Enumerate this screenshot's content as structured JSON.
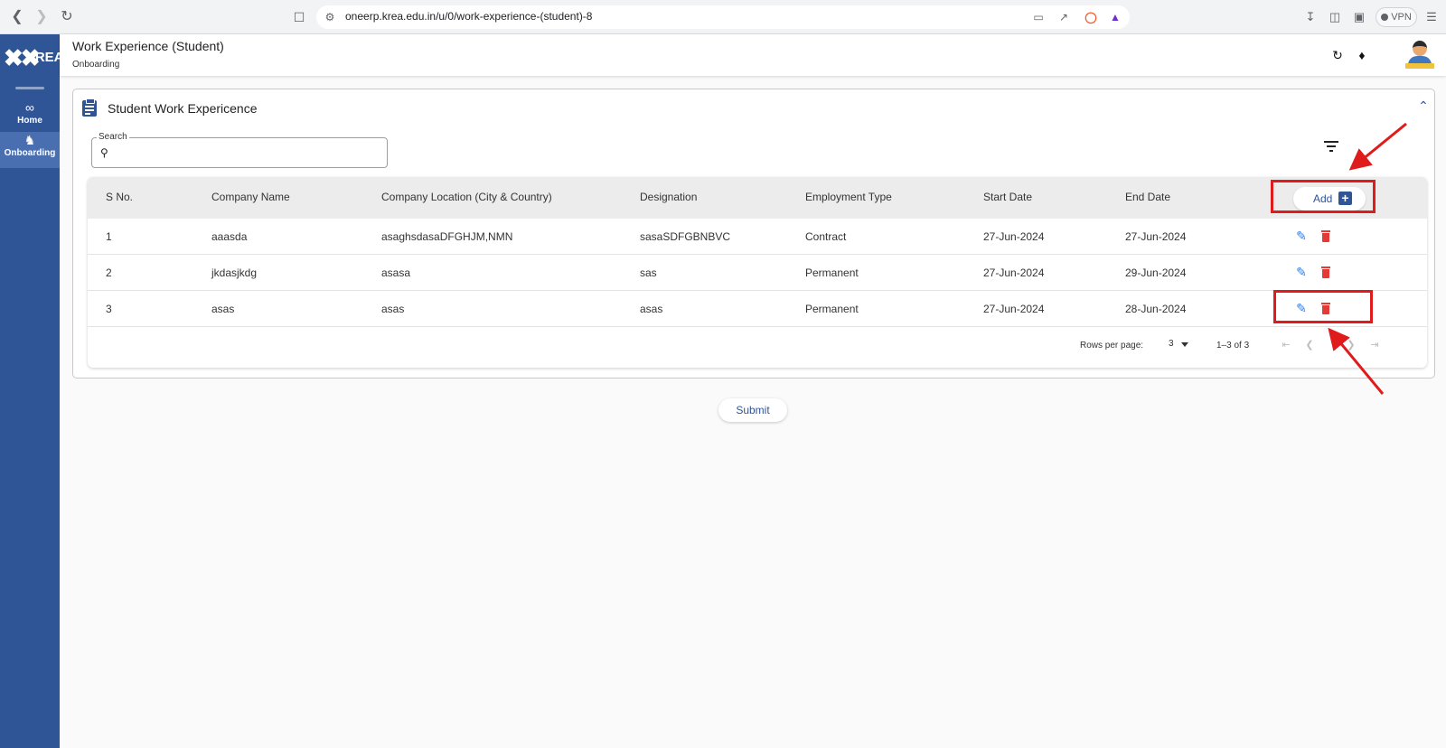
{
  "browser": {
    "url": "oneerp.krea.edu.in/u/0/work-experience-(student)-8",
    "vpn_label": "VPN",
    "brave_badge": "1"
  },
  "sidebar": {
    "logo_text": "KREA",
    "items": [
      {
        "label": "Home",
        "icon": "link-icon"
      },
      {
        "label": "Onboarding",
        "icon": "person-walk-icon",
        "active": true
      }
    ]
  },
  "header": {
    "title": "Work Experience (Student)",
    "subtitle": "Onboarding"
  },
  "card": {
    "title": "Student Work Expericence"
  },
  "search": {
    "label": "Search",
    "value": ""
  },
  "table": {
    "columns": [
      "S No.",
      "Company Name",
      "Company Location (City & Country)",
      "Designation",
      "Employment Type",
      "Start Date",
      "End Date"
    ],
    "add_label": "Add",
    "rows": [
      [
        "1",
        "aaasda",
        "asaghsdasaDFGHJM,NMN",
        "sasaSDFGBNBVC",
        "Contract",
        "27-Jun-2024",
        "27-Jun-2024"
      ],
      [
        "2",
        "jkdasjkdg",
        "asasa",
        "sas",
        "Permanent",
        "27-Jun-2024",
        "29-Jun-2024"
      ],
      [
        "3",
        "asas",
        "asas",
        "asas",
        "Permanent",
        "27-Jun-2024",
        "28-Jun-2024"
      ]
    ]
  },
  "pagination": {
    "rows_per_page_label": "Rows per page:",
    "rows_per_page_value": "3",
    "range": "1–3 of 3"
  },
  "submit_label": "Submit",
  "colors": {
    "brand": "#2f5597",
    "edit": "#2f7de1",
    "delete": "#e53935",
    "annotation": "#e01b1b"
  }
}
